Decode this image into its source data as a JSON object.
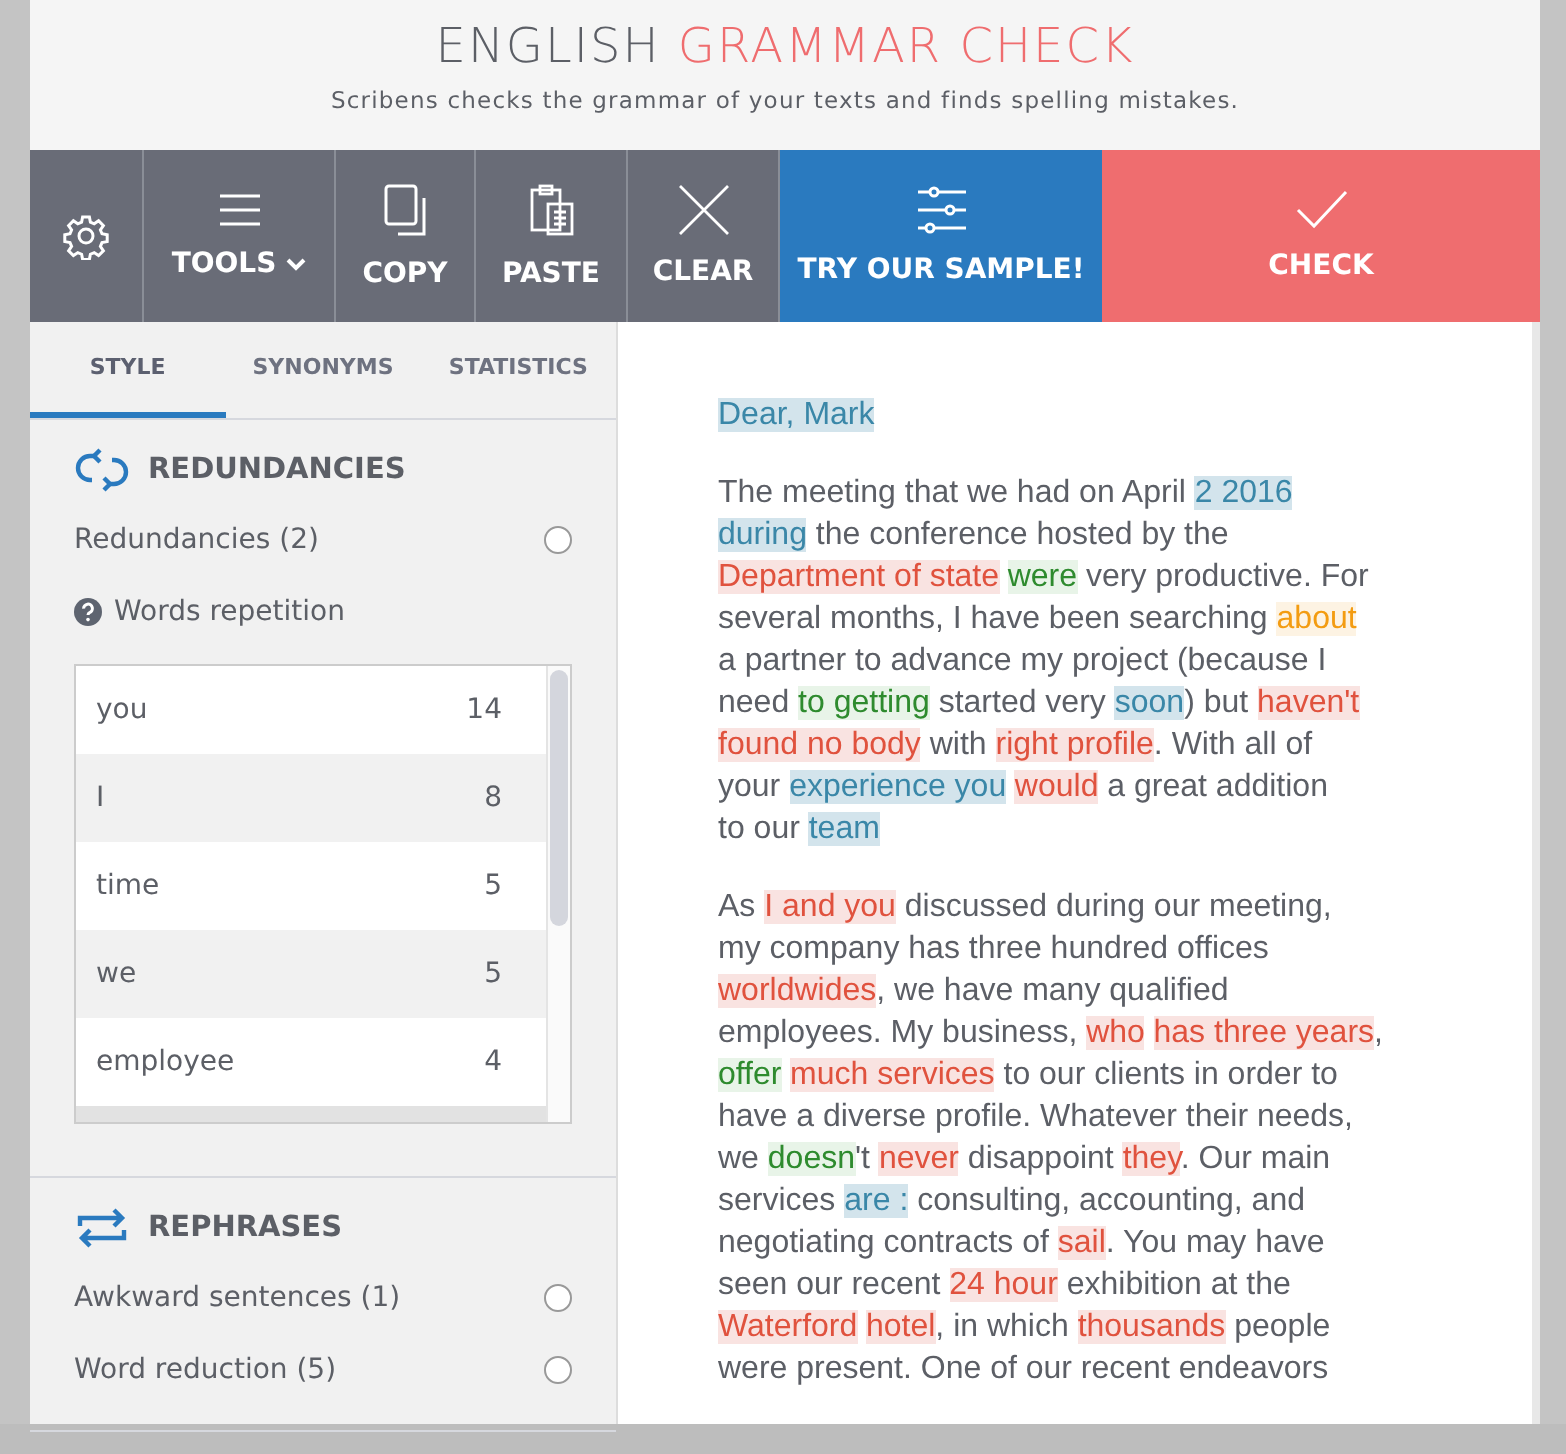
{
  "header": {
    "title_main": "ENGLISH",
    "title_accent": "GRAMMAR CHECK",
    "subtitle": "Scribens checks the grammar of your texts and finds spelling mistakes."
  },
  "toolbar": [
    {
      "kind": "settings"
    },
    {
      "kind": "tools",
      "label": "TOOLS"
    },
    {
      "kind": "copy",
      "label": "COPY"
    },
    {
      "kind": "paste",
      "label": "PASTE"
    },
    {
      "kind": "clear",
      "label": "CLEAR"
    },
    {
      "kind": "sample",
      "label": "TRY OUR SAMPLE!"
    },
    {
      "kind": "check",
      "label": "CHECK"
    }
  ],
  "sidebar": {
    "tabs": [
      {
        "label": "STYLE",
        "selected": true
      },
      {
        "label": "SYNONYMS",
        "selected": false
      },
      {
        "label": "STATISTICS",
        "selected": false
      }
    ],
    "sections": [
      {
        "kind": "redundancies",
        "title": "REDUNDANCIES",
        "options": [
          {
            "label": "Redundancies (2)",
            "checked": false
          }
        ],
        "help_label": "Words repetition",
        "words": [
          {
            "word": "you",
            "count": "14"
          },
          {
            "word": "I",
            "count": "8"
          },
          {
            "word": "time",
            "count": "5"
          },
          {
            "word": "we",
            "count": "5"
          },
          {
            "word": "employee",
            "count": "4"
          }
        ]
      },
      {
        "kind": "rephrases",
        "title": "REPHRASES",
        "options": [
          {
            "label": "Awkward sentences (1)",
            "checked": false
          },
          {
            "label": "Word reduction (5)",
            "checked": false
          }
        ]
      }
    ]
  },
  "editor": {
    "paragraphs": [
      [
        [
          {
            "kind": "blue",
            "text": "Dear, Mark"
          }
        ]
      ],
      [
        [
          {
            "kind": "plain",
            "text": "The meeting that we had on April "
          },
          {
            "kind": "blue",
            "text": "2 2016"
          }
        ],
        [
          {
            "kind": "blue",
            "text": "during"
          },
          {
            "kind": "plain",
            "text": " the conference hosted by the"
          }
        ],
        [
          {
            "kind": "red",
            "text": "Department of state"
          },
          {
            "kind": "green",
            "text": "were"
          },
          {
            "kind": "plain",
            "text": " very productive. For"
          }
        ],
        [
          {
            "kind": "plain",
            "text": "several months, I have been searching "
          },
          {
            "kind": "orange",
            "text": "about"
          }
        ],
        [
          {
            "kind": "plain",
            "text": "a partner to advance my project (because I"
          }
        ],
        [
          {
            "kind": "plain",
            "text": "need "
          },
          {
            "kind": "green",
            "text": "to getting"
          },
          {
            "kind": "plain",
            "text": " started very "
          },
          {
            "kind": "blue",
            "text": "soon"
          },
          {
            "kind": "plain",
            "text": ") but "
          },
          {
            "kind": "red",
            "text": "haven't"
          }
        ],
        [
          {
            "kind": "red",
            "text": "found no body"
          },
          {
            "kind": "plain",
            "text": " with "
          },
          {
            "kind": "red",
            "text": "right profile"
          },
          {
            "kind": "plain",
            "text": ". With all of"
          }
        ],
        [
          {
            "kind": "plain",
            "text": "your "
          },
          {
            "kind": "blue",
            "text": "experience you"
          },
          {
            "kind": "red",
            "text": "would"
          },
          {
            "kind": "plain",
            "text": " a great addition"
          }
        ],
        [
          {
            "kind": "plain",
            "text": "to our "
          },
          {
            "kind": "blue",
            "text": "team"
          }
        ]
      ],
      [
        [
          {
            "kind": "plain",
            "text": "As "
          },
          {
            "kind": "red",
            "text": "I and you"
          },
          {
            "kind": "plain",
            "text": " discussed during our meeting,"
          }
        ],
        [
          {
            "kind": "plain",
            "text": "my company has three hundred offices"
          }
        ],
        [
          {
            "kind": "red",
            "text": "worldwides"
          },
          {
            "kind": "plain",
            "text": ", we have many qualified"
          }
        ],
        [
          {
            "kind": "plain",
            "text": "employees. My business, "
          },
          {
            "kind": "red",
            "text": "who"
          },
          {
            "kind": "red",
            "text": "has three years"
          },
          {
            "kind": "plain",
            "text": ","
          }
        ],
        [
          {
            "kind": "green",
            "text": "offer"
          },
          {
            "kind": "red",
            "text": "much services"
          },
          {
            "kind": "plain",
            "text": " to our clients in order to"
          }
        ],
        [
          {
            "kind": "plain",
            "text": "have a diverse profile. Whatever their needs,"
          }
        ],
        [
          {
            "kind": "plain",
            "text": "we "
          },
          {
            "kind": "green",
            "text": "doesn"
          },
          {
            "kind": "plain",
            "text": "'t "
          },
          {
            "kind": "red",
            "text": "never"
          },
          {
            "kind": "plain",
            "text": " disappoint "
          },
          {
            "kind": "red",
            "text": "they"
          },
          {
            "kind": "plain",
            "text": ". Our main"
          }
        ],
        [
          {
            "kind": "plain",
            "text": "services "
          },
          {
            "kind": "blue",
            "text": "are :"
          },
          {
            "kind": "plain",
            "text": " consulting, accounting, and"
          }
        ],
        [
          {
            "kind": "plain",
            "text": "negotiating contracts of "
          },
          {
            "kind": "red",
            "text": "sail"
          },
          {
            "kind": "plain",
            "text": ". You may have"
          }
        ],
        [
          {
            "kind": "plain",
            "text": "seen our recent "
          },
          {
            "kind": "red",
            "text": "24 hour"
          },
          {
            "kind": "plain",
            "text": " exhibition at the"
          }
        ],
        [
          {
            "kind": "red",
            "text": "Waterford"
          },
          {
            "kind": "red",
            "text": "hotel"
          },
          {
            "kind": "plain",
            "text": ", in which "
          },
          {
            "kind": "red",
            "text": "thousands"
          },
          {
            "kind": "plain",
            "text": " people"
          }
        ],
        [
          {
            "kind": "plain",
            "text": "were present. One of our recent endeavors"
          }
        ]
      ]
    ]
  }
}
